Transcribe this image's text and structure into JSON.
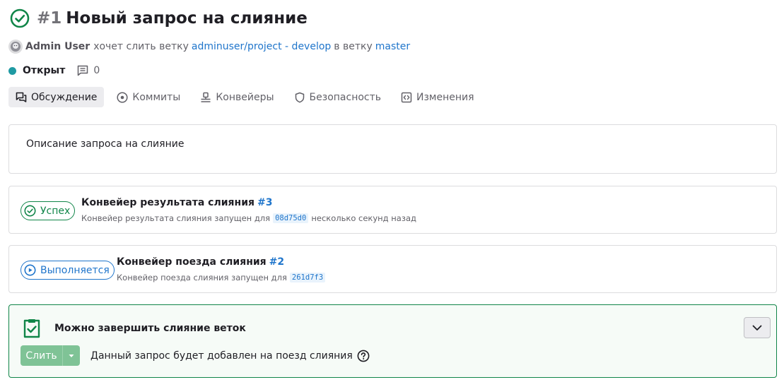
{
  "header": {
    "iid": "#1",
    "title": "Новый запрос на слияние"
  },
  "meta": {
    "author": "Admin User",
    "wants_merge": "хочет слить ветку",
    "source_branch": "adminuser/project - develop",
    "into": "в ветку",
    "target_branch": "master"
  },
  "state": {
    "label": "Открыт",
    "comments": "0"
  },
  "tabs": [
    {
      "label": "Обсуждение",
      "icon": "discussion-icon",
      "active": true
    },
    {
      "label": "Коммиты",
      "icon": "commit-icon"
    },
    {
      "label": "Конвейеры",
      "icon": "pipeline-icon"
    },
    {
      "label": "Безопасность",
      "icon": "shield-icon"
    },
    {
      "label": "Изменения",
      "icon": "code-icon"
    }
  ],
  "description": "Описание запроса на слияние",
  "pipelines": [
    {
      "status": "Успех",
      "title": "Конвейер результата слияния",
      "number": "#3",
      "sub_prefix": "Конвейер результата слияния запущен для",
      "sha": "08d75d0",
      "sub_suffix": "несколько секунд назад"
    },
    {
      "status": "Выполняется",
      "title": "Конвейер поезда слияния",
      "number": "#2",
      "sub_prefix": "Конвейер поезда слияния запущен для",
      "sha": "261d7f3"
    }
  ],
  "merge": {
    "title": "Можно завершить слияние веток",
    "button": "Слить",
    "note": "Данный запрос будет добавлен на поезд слияния"
  },
  "colors": {
    "success": "#108548",
    "link": "#1f75cb",
    "open": "#1f9aa3"
  }
}
